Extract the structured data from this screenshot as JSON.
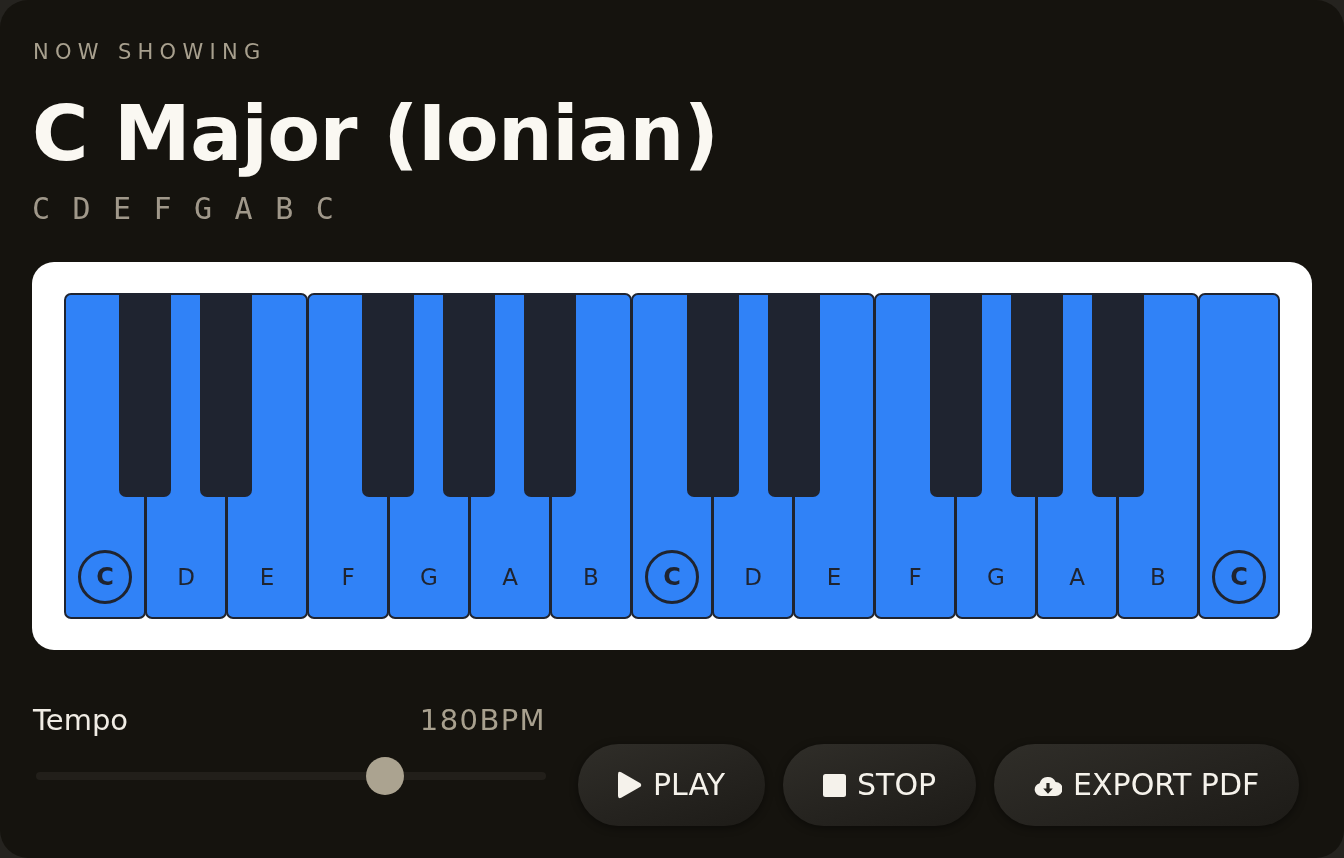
{
  "header": {
    "eyebrow": "NOW SHOWING",
    "title": "C Major (Ionian)",
    "scale_notes": "C D E F G A B C"
  },
  "keyboard": {
    "white_keys": [
      {
        "note": "C",
        "root": true,
        "in_scale": true,
        "black_key": {
          "in_scale": false
        }
      },
      {
        "note": "D",
        "root": false,
        "in_scale": true,
        "black_key": {
          "in_scale": false
        }
      },
      {
        "note": "E",
        "root": false,
        "in_scale": true
      },
      {
        "note": "F",
        "root": false,
        "in_scale": true,
        "black_key": {
          "in_scale": false
        }
      },
      {
        "note": "G",
        "root": false,
        "in_scale": true,
        "black_key": {
          "in_scale": false
        }
      },
      {
        "note": "A",
        "root": false,
        "in_scale": true,
        "black_key": {
          "in_scale": false
        }
      },
      {
        "note": "B",
        "root": false,
        "in_scale": true
      },
      {
        "note": "C",
        "root": true,
        "in_scale": true,
        "black_key": {
          "in_scale": false
        }
      },
      {
        "note": "D",
        "root": false,
        "in_scale": true,
        "black_key": {
          "in_scale": false
        }
      },
      {
        "note": "E",
        "root": false,
        "in_scale": true
      },
      {
        "note": "F",
        "root": false,
        "in_scale": true,
        "black_key": {
          "in_scale": false
        }
      },
      {
        "note": "G",
        "root": false,
        "in_scale": true,
        "black_key": {
          "in_scale": false
        }
      },
      {
        "note": "A",
        "root": false,
        "in_scale": true,
        "black_key": {
          "in_scale": false
        }
      },
      {
        "note": "B",
        "root": false,
        "in_scale": true
      },
      {
        "note": "C",
        "root": true,
        "in_scale": true
      }
    ]
  },
  "tempo": {
    "label": "Tempo",
    "reading": "180BPM",
    "level": 0.7
  },
  "buttons": [
    {
      "kind": "play",
      "label": "PLAY"
    },
    {
      "kind": "stop",
      "label": "STOP"
    },
    {
      "kind": "export",
      "label": "EXPORT PDF"
    }
  ]
}
